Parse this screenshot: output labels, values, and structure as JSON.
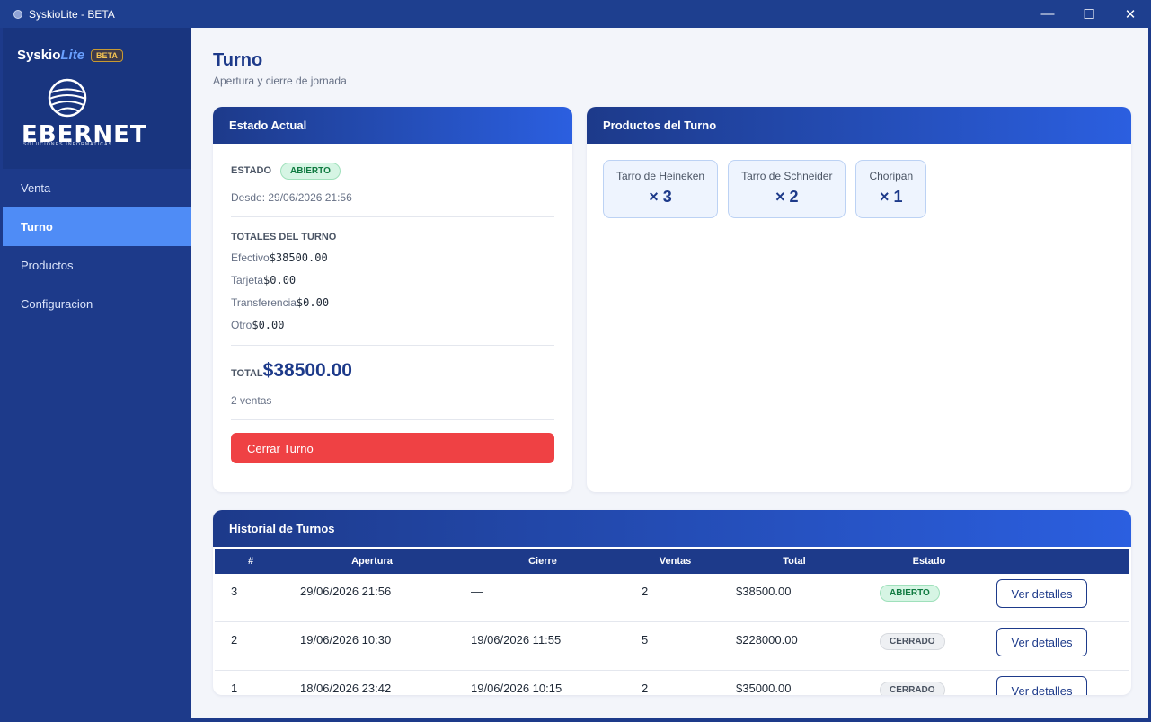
{
  "window": {
    "title": "SyskioLite - BETA",
    "minimize": "—",
    "maximize": "☐",
    "close": "✕"
  },
  "sidebar": {
    "brand_main": "Syskio",
    "brand_lite": "Lite",
    "beta": "BETA",
    "logo_text": "EBERNET",
    "logo_sub": "SOLUCIONES INFORMATICAS",
    "items": [
      {
        "label": "Venta"
      },
      {
        "label": "Turno"
      },
      {
        "label": "Productos"
      },
      {
        "label": "Configuracion"
      }
    ],
    "active_index": 1
  },
  "page": {
    "title": "Turno",
    "subtitle": "Apertura y cierre de jornada"
  },
  "estado": {
    "header": "Estado Actual",
    "estado_label": "ESTADO",
    "estado_value": "ABIERTO",
    "desde": "Desde: 29/06/2026 21:56",
    "totales_label": "TOTALES DEL TURNO",
    "totales": [
      {
        "label": "Efectivo",
        "value": "$38500.00"
      },
      {
        "label": "Tarjeta",
        "value": "$0.00"
      },
      {
        "label": "Transferencia",
        "value": "$0.00"
      },
      {
        "label": "Otro",
        "value": "$0.00"
      }
    ],
    "total_label": "TOTAL",
    "total_value": "$38500.00",
    "ventas": "2 ventas",
    "cerrar_label": "Cerrar Turno"
  },
  "productos": {
    "header": "Productos del Turno",
    "items": [
      {
        "name": "Tarro de Heineken",
        "qty": "× 3"
      },
      {
        "name": "Tarro de Schneider",
        "qty": "× 2"
      },
      {
        "name": "Choripan",
        "qty": "× 1"
      }
    ]
  },
  "historial": {
    "header": "Historial de Turnos",
    "columns": [
      "#",
      "Apertura",
      "Cierre",
      "Ventas",
      "Total",
      "Estado",
      ""
    ],
    "rows": [
      {
        "id": "3",
        "apertura": "29/06/2026 21:56",
        "cierre": "—",
        "ventas": "2",
        "total": "$38500.00",
        "estado": "ABIERTO",
        "action": "Ver detalles"
      },
      {
        "id": "2",
        "apertura": "19/06/2026 10:30",
        "cierre": "19/06/2026 11:55",
        "ventas": "5",
        "total": "$228000.00",
        "estado": "CERRADO",
        "action": "Ver detalles"
      },
      {
        "id": "1",
        "apertura": "18/06/2026 23:42",
        "cierre": "19/06/2026 10:15",
        "ventas": "2",
        "total": "$35000.00",
        "estado": "CERRADO",
        "action": "Ver detalles"
      }
    ]
  },
  "colors": {
    "primary": "#1d3a8a",
    "accent": "#4f8cf6",
    "danger": "#ef4144",
    "open": "#0f7a40"
  }
}
